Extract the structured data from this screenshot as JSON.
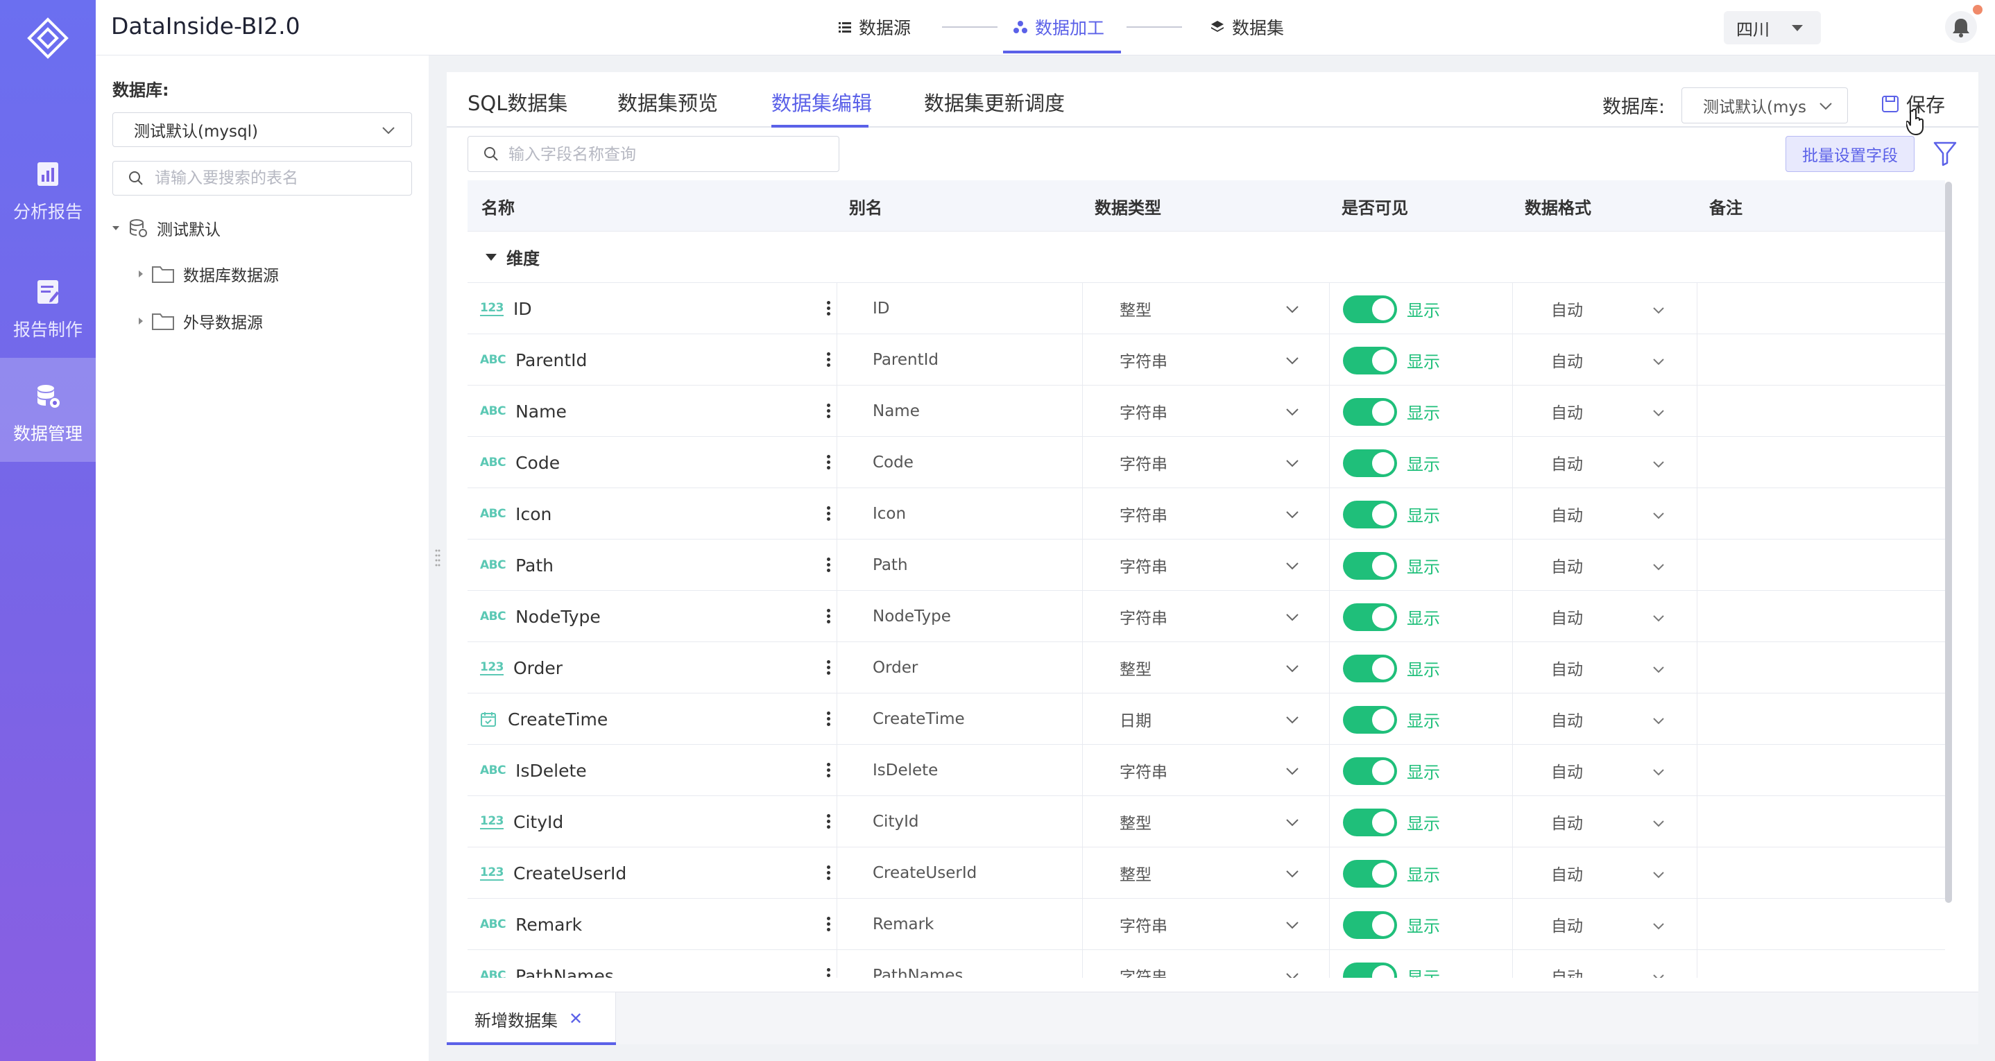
{
  "app": {
    "title": "DataInside-BI2.0"
  },
  "rail": {
    "items": [
      {
        "label": "分析报告",
        "icon": "report-chart-icon"
      },
      {
        "label": "报告制作",
        "icon": "report-edit-icon"
      },
      {
        "label": "数据管理",
        "icon": "database-settings-icon",
        "active": true
      }
    ]
  },
  "steps": [
    {
      "label": "数据源",
      "icon": "list-icon"
    },
    {
      "label": "数据加工",
      "icon": "process-icon",
      "active": true
    },
    {
      "label": "数据集",
      "icon": "layers-icon"
    }
  ],
  "header": {
    "region": "四川"
  },
  "left_panel": {
    "db_label": "数据库:",
    "db_selected": "测试默认(mysql)",
    "search_placeholder": "请输入要搜索的表名",
    "tree": {
      "root": "测试默认",
      "children": [
        "数据库数据源",
        "外导数据源"
      ]
    }
  },
  "tabs": [
    {
      "label": "SQL数据集"
    },
    {
      "label": "数据集预览"
    },
    {
      "label": "数据集编辑",
      "active": true
    },
    {
      "label": "数据集更新调度"
    }
  ],
  "toolbar": {
    "db_label": "数据库:",
    "db_selected": "测试默认(mys",
    "save_label": "保存",
    "field_search_placeholder": "输入字段名称查询",
    "batch_label": "批量设置字段"
  },
  "table": {
    "columns": [
      "名称",
      "别名",
      "数据类型",
      "是否可见",
      "数据格式",
      "备注"
    ],
    "group_label": "维度",
    "rows": [
      {
        "badge": "123",
        "badge_kind": "num",
        "name": "ID",
        "alias": "ID",
        "type": "整型",
        "visible": "显示",
        "format": "自动"
      },
      {
        "badge": "ABC",
        "badge_kind": "str",
        "name": "ParentId",
        "alias": "ParentId",
        "type": "字符串",
        "visible": "显示",
        "format": "自动"
      },
      {
        "badge": "ABC",
        "badge_kind": "str",
        "name": "Name",
        "alias": "Name",
        "type": "字符串",
        "visible": "显示",
        "format": "自动"
      },
      {
        "badge": "ABC",
        "badge_kind": "str",
        "name": "Code",
        "alias": "Code",
        "type": "字符串",
        "visible": "显示",
        "format": "自动"
      },
      {
        "badge": "ABC",
        "badge_kind": "str",
        "name": "Icon",
        "alias": "Icon",
        "type": "字符串",
        "visible": "显示",
        "format": "自动"
      },
      {
        "badge": "ABC",
        "badge_kind": "str",
        "name": "Path",
        "alias": "Path",
        "type": "字符串",
        "visible": "显示",
        "format": "自动"
      },
      {
        "badge": "ABC",
        "badge_kind": "str",
        "name": "NodeType",
        "alias": "NodeType",
        "type": "字符串",
        "visible": "显示",
        "format": "自动"
      },
      {
        "badge": "123",
        "badge_kind": "num",
        "name": "Order",
        "alias": "Order",
        "type": "整型",
        "visible": "显示",
        "format": "自动"
      },
      {
        "badge": "",
        "badge_kind": "date",
        "name": "CreateTime",
        "alias": "CreateTime",
        "type": "日期",
        "visible": "显示",
        "format": "自动"
      },
      {
        "badge": "ABC",
        "badge_kind": "str",
        "name": "IsDelete",
        "alias": "IsDelete",
        "type": "字符串",
        "visible": "显示",
        "format": "自动"
      },
      {
        "badge": "123",
        "badge_kind": "num",
        "name": "CityId",
        "alias": "CityId",
        "type": "整型",
        "visible": "显示",
        "format": "自动"
      },
      {
        "badge": "123",
        "badge_kind": "num",
        "name": "CreateUserId",
        "alias": "CreateUserId",
        "type": "整型",
        "visible": "显示",
        "format": "自动"
      },
      {
        "badge": "ABC",
        "badge_kind": "str",
        "name": "Remark",
        "alias": "Remark",
        "type": "字符串",
        "visible": "显示",
        "format": "自动"
      },
      {
        "badge": "ABC",
        "badge_kind": "str",
        "name": "PathNames",
        "alias": "PathNames",
        "type": "字符串",
        "visible": "显示",
        "format": "自动"
      }
    ]
  },
  "bottom": {
    "dataset_tab": "新增数据集",
    "close_glyph": "✕"
  },
  "colors": {
    "accent": "#5b61e8",
    "toggle_on": "#1fbf7a",
    "badge": "#5bc8b4",
    "rail_top": "#6b6ff0",
    "rail_bottom": "#8a5fe2"
  }
}
